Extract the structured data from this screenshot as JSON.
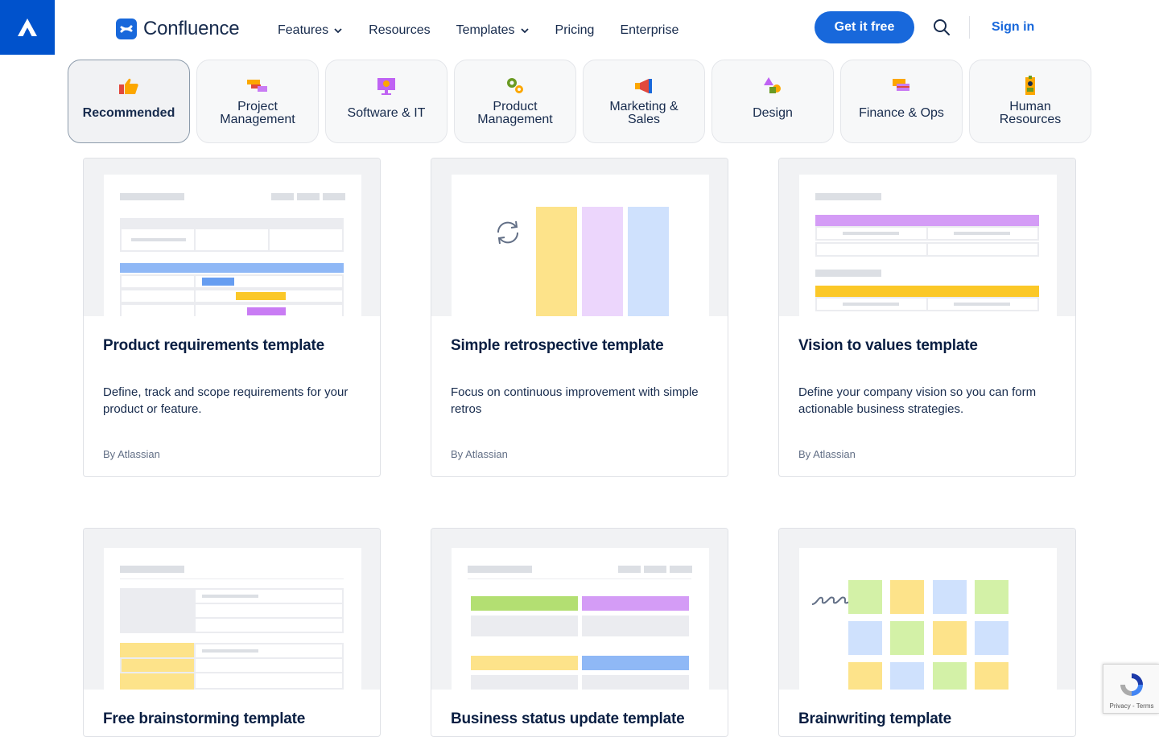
{
  "header": {
    "brand_name": "Confluence",
    "nav": [
      {
        "label": "Features",
        "has_dropdown": true
      },
      {
        "label": "Resources",
        "has_dropdown": false
      },
      {
        "label": "Templates",
        "has_dropdown": true
      },
      {
        "label": "Pricing",
        "has_dropdown": false
      },
      {
        "label": "Enterprise",
        "has_dropdown": false
      }
    ],
    "cta_label": "Get it free",
    "signin_label": "Sign in"
  },
  "tabs": [
    {
      "label": "Recommended",
      "icon": "thumbs-up-icon",
      "active": true
    },
    {
      "label": "Project\nManagement",
      "icon": "project-management-icon",
      "active": false
    },
    {
      "label": "Software & IT",
      "icon": "monitor-icon",
      "active": false
    },
    {
      "label": "Product\nManagement",
      "icon": "gears-icon",
      "active": false
    },
    {
      "label": "Marketing &\nSales",
      "icon": "megaphone-icon",
      "active": false
    },
    {
      "label": "Design",
      "icon": "shapes-icon",
      "active": false
    },
    {
      "label": "Finance & Ops",
      "icon": "cards-icon",
      "active": false
    },
    {
      "label": "Human\nResources",
      "icon": "id-badge-icon",
      "active": false
    }
  ],
  "cards": [
    {
      "title": "Product requirements template",
      "description": "Define, track and scope requirements for your product or feature.",
      "author": "By Atlassian"
    },
    {
      "title": "Simple retrospective template",
      "description": "Focus on continuous improvement with simple retros",
      "author": "By Atlassian"
    },
    {
      "title": "Vision to values template",
      "description": "Define your company vision so you can form actionable business strategies.",
      "author": "By Atlassian"
    },
    {
      "title": "Free brainstorming template"
    },
    {
      "title": "Business status update template"
    },
    {
      "title": "Brainwriting template"
    }
  ],
  "recaptcha": {
    "links": "Privacy - Terms"
  },
  "colors": {
    "brand_blue": "#1868db",
    "atlassian_blue": "#0052cc",
    "purple": "#d49cf6",
    "yellow": "#fbc828",
    "blue": "#8fb8f6",
    "green": "#b3df72"
  }
}
